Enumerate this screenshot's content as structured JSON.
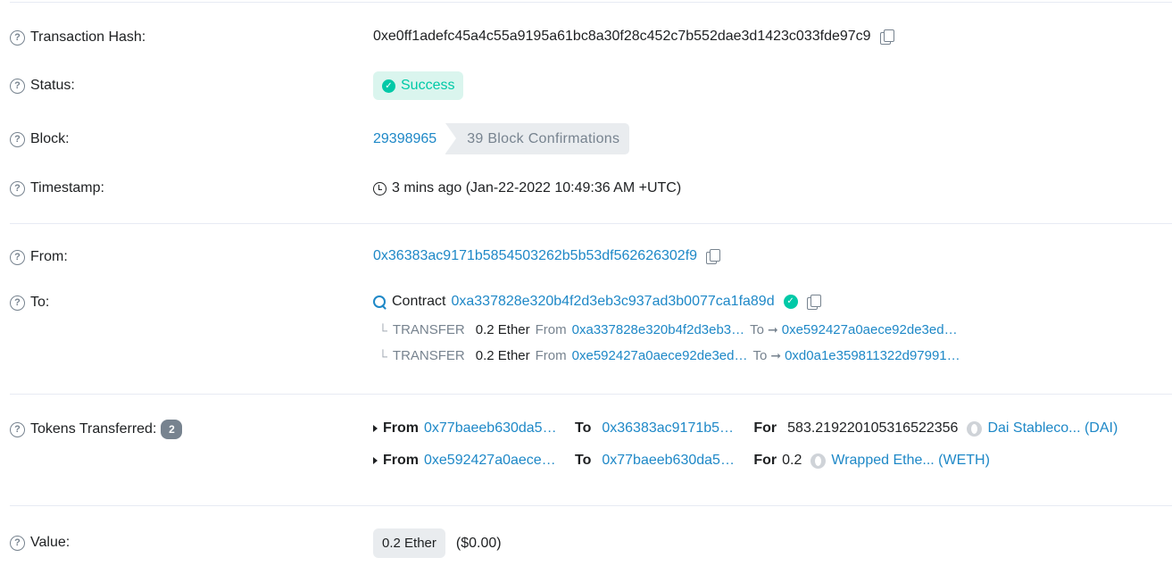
{
  "tx_hash": {
    "label": "Transaction Hash:",
    "value": "0xe0ff1adefc45a4c55a9195a61bc8a30f28c452c7b552dae3d1423c033fde97c9"
  },
  "status": {
    "label": "Status:",
    "value": "Success",
    "color": "#00c9a7"
  },
  "block": {
    "label": "Block:",
    "number": "29398965",
    "confirmations": "39 Block Confirmations"
  },
  "timestamp": {
    "label": "Timestamp:",
    "value": "3 mins ago (Jan-22-2022 10:49:36 AM +UTC)"
  },
  "from": {
    "label": "From:",
    "address": "0x36383ac9171b5854503262b5b53df562626302f9"
  },
  "to": {
    "label": "To:",
    "prefix": "Contract",
    "address": "0xa337828e320b4f2d3eb3c937ad3b0077ca1fa89d",
    "internal": [
      {
        "type": "TRANSFER",
        "amount": "0.2 Ether",
        "from_word": "From",
        "from": "0xa337828e320b4f2d3eb3…",
        "to_word": "To",
        "to": "0xe592427a0aece92de3ed…"
      },
      {
        "type": "TRANSFER",
        "amount": "0.2 Ether",
        "from_word": "From",
        "from": "0xe592427a0aece92de3ed…",
        "to_word": "To",
        "to": "0xd0a1e359811322d97991…"
      }
    ]
  },
  "tokens": {
    "label": "Tokens Transferred:",
    "count": "2",
    "transfers": [
      {
        "from_word": "From",
        "from": "0x77baeeb630da5…",
        "to_word": "To",
        "to": "0x36383ac9171b5…",
        "for_word": "For",
        "amount": "583.219220105316522356",
        "token": "Dai Stableco... (DAI)"
      },
      {
        "from_word": "From",
        "from": "0xe592427a0aece…",
        "to_word": "To",
        "to": "0x77baeeb630da5…",
        "for_word": "For",
        "amount": "0.2",
        "token": "Wrapped Ethe... (WETH)"
      }
    ]
  },
  "value": {
    "label": "Value:",
    "amount": "0.2 Ether",
    "usd": "($0.00)"
  },
  "colors": {
    "link": "#1e88c7",
    "success": "#00c9a7",
    "muted": "#77838f"
  }
}
